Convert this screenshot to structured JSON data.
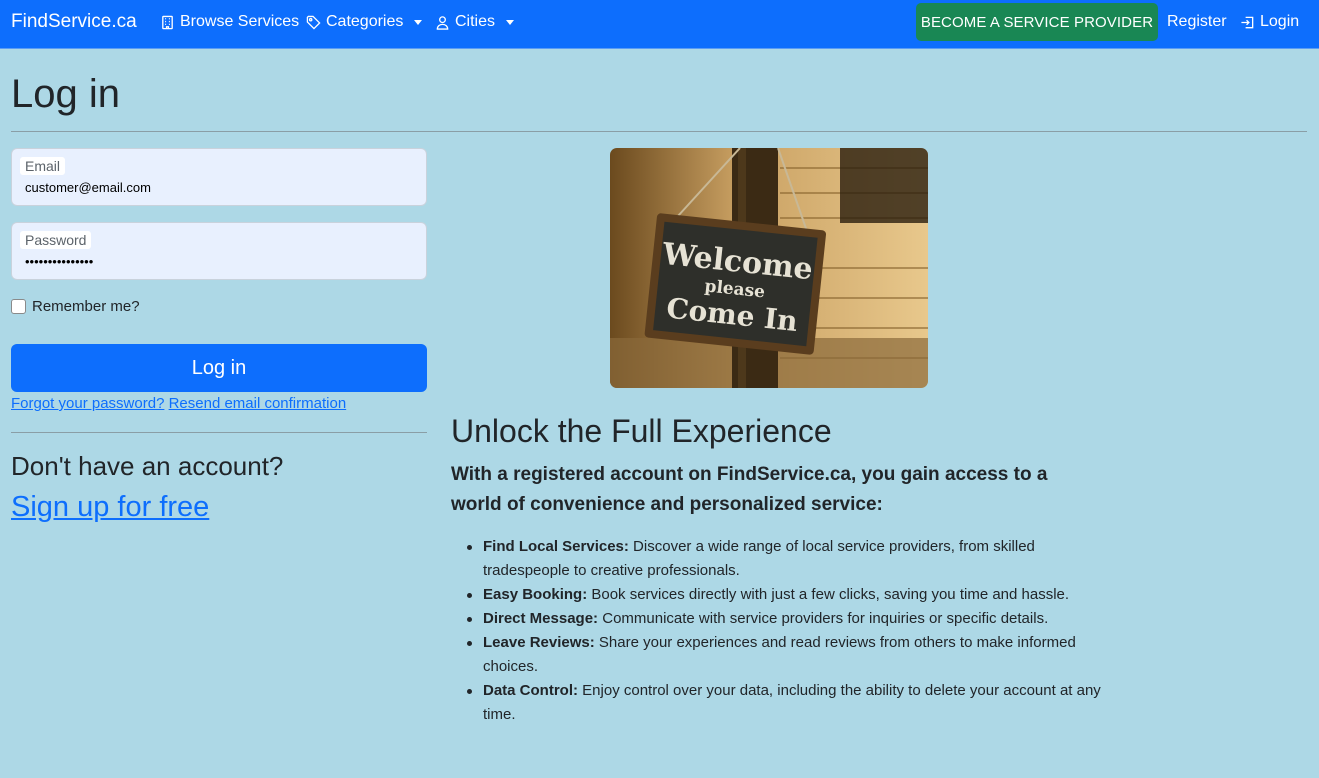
{
  "nav": {
    "brand": "FindService.ca",
    "browse": "Browse Services",
    "categories": "Categories",
    "cities": "Cities",
    "become_provider": "BECOME A SERVICE PROVIDER",
    "register": "Register",
    "login": "Login"
  },
  "page": {
    "title": "Log in"
  },
  "form": {
    "email_label": "Email",
    "email_value": "customer@email.com",
    "password_label": "Password",
    "password_value": "•••••••••••••••",
    "remember": "Remember me?",
    "submit": "Log in",
    "forgot": "Forgot your password?",
    "resend": "Resend email confirmation"
  },
  "signup": {
    "heading": "Don't have an account?",
    "link": "Sign up for free"
  },
  "hero": {
    "sign_line1": "Welcome",
    "sign_line2": "please",
    "sign_line3": "Come In"
  },
  "info": {
    "title": "Unlock the Full Experience",
    "intro": "With a registered account on FindService.ca, you gain access to a world of convenience and personalized service:",
    "items": [
      {
        "title": "Find Local Services:",
        "text": " Discover a wide range of local service providers, from skilled tradespeople to creative professionals."
      },
      {
        "title": "Easy Booking:",
        "text": " Book services directly with just a few clicks, saving you time and hassle."
      },
      {
        "title": "Direct Message:",
        "text": " Communicate with service providers for inquiries or specific details."
      },
      {
        "title": "Leave Reviews:",
        "text": " Share your experiences and read reviews from others to make informed choices."
      },
      {
        "title": "Data Control:",
        "text": " Enjoy control over your data, including the ability to delete your account at any time."
      }
    ]
  },
  "colors": {
    "page_bg": "#add8e6",
    "primary": "#0d6efd",
    "success": "#198754"
  }
}
